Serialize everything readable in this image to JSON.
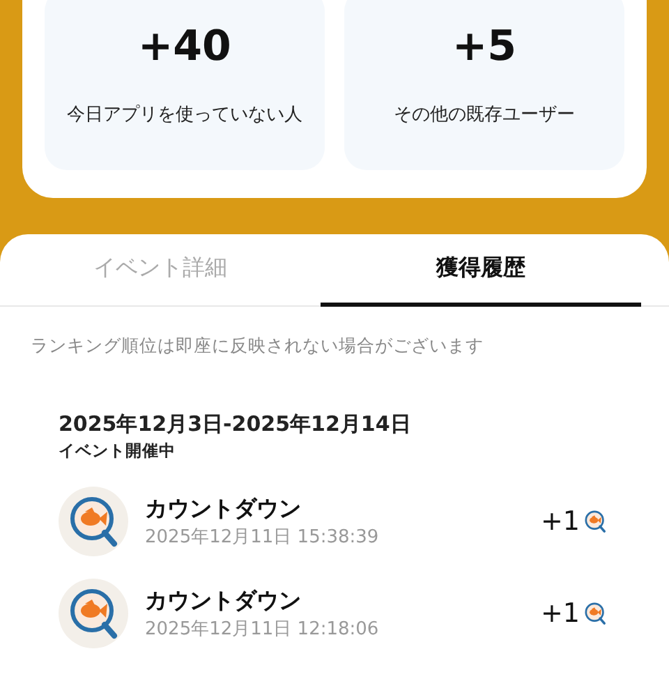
{
  "stats": [
    {
      "value": "+40",
      "label": "今日アプリを使っていない人"
    },
    {
      "value": "+5",
      "label": "その他の既存ユーザー"
    }
  ],
  "tabs": [
    {
      "label": "イベント詳細",
      "selected": false
    },
    {
      "label": "獲得履歴",
      "selected": true
    }
  ],
  "notice": "ランキング順位は即座に反映されない場合がございます",
  "period": {
    "dates": "2025年12月3日-2025年12月14日",
    "status": "イベント開催中"
  },
  "history": [
    {
      "title": "カウントダウン",
      "time": "2025年12月11日 15:38:39",
      "points": "+1"
    },
    {
      "title": "カウントダウン",
      "time": "2025年12月11日 12:18:06",
      "points": "+1"
    }
  ]
}
